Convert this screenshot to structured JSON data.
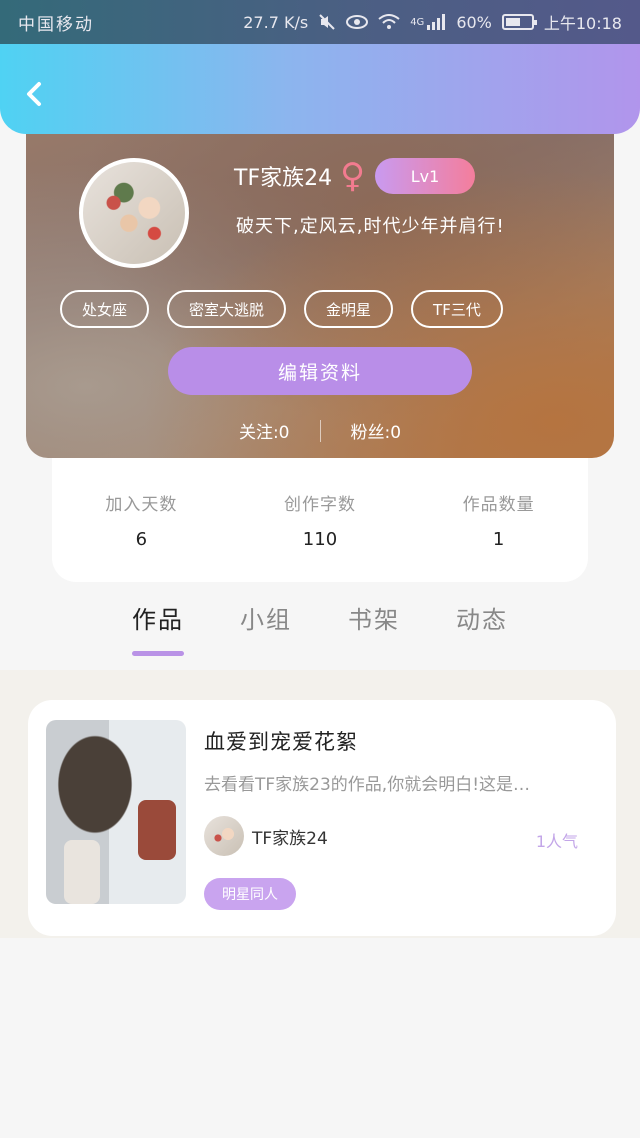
{
  "status_bar": {
    "carrier": "中国移动",
    "speed": "27.7 K/s",
    "network": "4G",
    "battery": "60%",
    "battery_level": 0.6,
    "time": "上午10:18"
  },
  "profile": {
    "username": "TF家族24",
    "gender_icon": "female-icon",
    "level": "Lv1",
    "bio": "破天下,定风云,时代少年并肩行!",
    "tags": [
      "处女座",
      "密室大逃脱",
      "金明星",
      "TF三代"
    ],
    "edit_label": "编辑资料",
    "following_label": "关注:0",
    "followers_label": "粉丝:0"
  },
  "stats": [
    {
      "label": "加入天数",
      "value": "6"
    },
    {
      "label": "创作字数",
      "value": "110"
    },
    {
      "label": "作品数量",
      "value": "1"
    }
  ],
  "tabs": [
    {
      "label": "作品",
      "active": true
    },
    {
      "label": "小组",
      "active": false
    },
    {
      "label": "书架",
      "active": false
    },
    {
      "label": "动态",
      "active": false
    }
  ],
  "works": [
    {
      "title": "血爱到宠爱花絮",
      "excerpt": "去看看TF家族23的作品,你就会明白!这是…",
      "author": "TF家族24",
      "popularity": "1人气",
      "category": "明星同人"
    }
  ],
  "colors": {
    "accent": "#b98ee8",
    "header_start": "#4fd2f3",
    "header_end": "#b195ec"
  }
}
